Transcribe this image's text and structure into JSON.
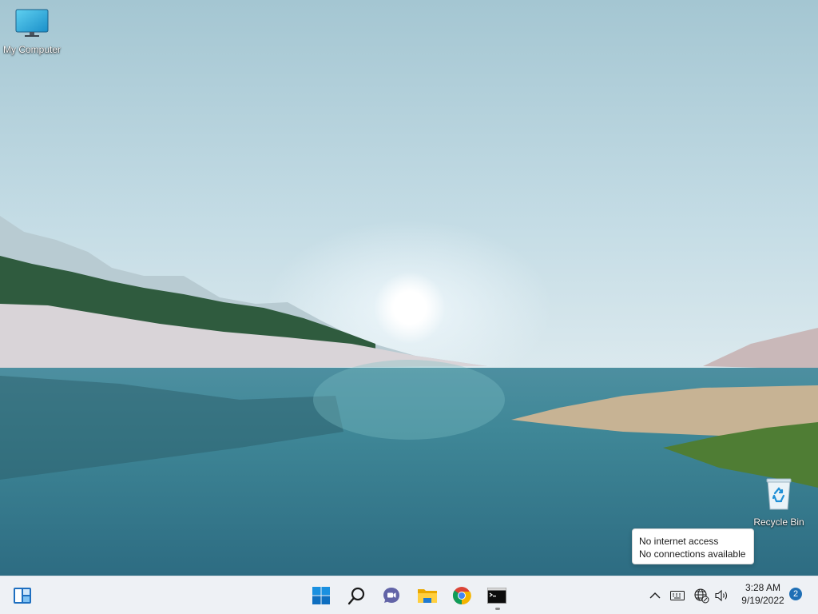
{
  "desktop": {
    "icons": [
      {
        "label": "My Computer"
      },
      {
        "label": "Recycle Bin"
      }
    ]
  },
  "tooltip": {
    "line1": "No internet access",
    "line2": "No connections available"
  },
  "taskbar": {
    "pinned": [
      {
        "icon": "widgets-icon"
      },
      {
        "icon": "windows-start-icon"
      },
      {
        "icon": "search-icon"
      },
      {
        "icon": "teams-chat-icon"
      },
      {
        "icon": "file-explorer-icon"
      },
      {
        "icon": "chrome-icon"
      },
      {
        "icon": "command-prompt-icon",
        "running": true
      }
    ],
    "tray": {
      "icons": [
        "chevron-up-icon",
        "keyboard-icon",
        "network-globe-icon",
        "volume-icon"
      ],
      "time": "3:28 AM",
      "date": "9/19/2022",
      "notification_count": "2"
    }
  },
  "colors": {
    "accent": "#1f6fb5",
    "taskbar_bg": "#eef1f5"
  }
}
